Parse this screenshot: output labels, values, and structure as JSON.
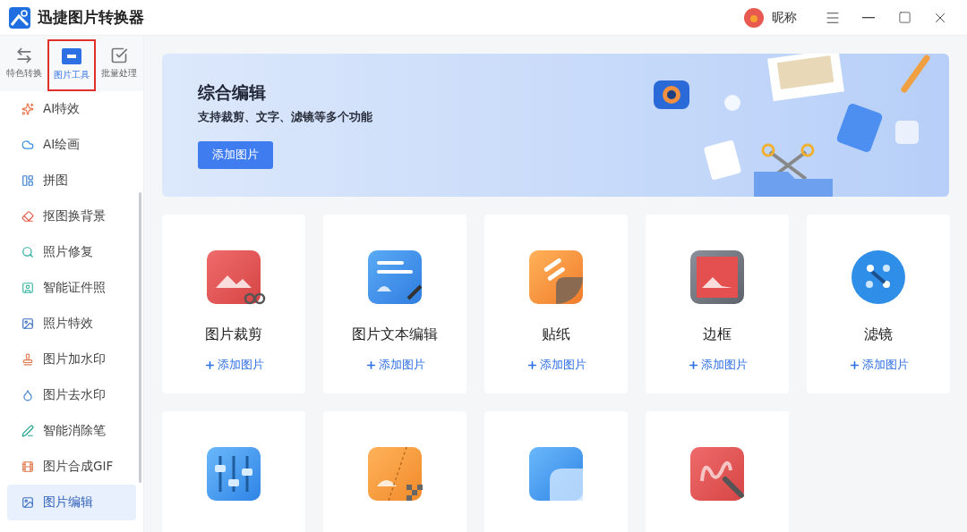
{
  "window": {
    "title": "迅捷图片转换器",
    "user": "昵称"
  },
  "mode_tabs": [
    {
      "label": "特色转换",
      "kind": "convert",
      "selected": false
    },
    {
      "label": "图片工具",
      "kind": "tools",
      "selected": true
    },
    {
      "label": "批量处理",
      "kind": "batch",
      "selected": false
    }
  ],
  "sidebar": {
    "items": [
      {
        "label": "AI特效",
        "kind": "sparkle",
        "selected": false
      },
      {
        "label": "AI绘画",
        "kind": "cloud",
        "selected": false
      },
      {
        "label": "拼图",
        "kind": "grid",
        "selected": false
      },
      {
        "label": "抠图换背景",
        "kind": "eraser",
        "selected": false
      },
      {
        "label": "照片修复",
        "kind": "search",
        "selected": false
      },
      {
        "label": "智能证件照",
        "kind": "person",
        "selected": false
      },
      {
        "label": "照片特效",
        "kind": "image",
        "selected": false
      },
      {
        "label": "图片加水印",
        "kind": "stamp",
        "selected": false
      },
      {
        "label": "图片去水印",
        "kind": "drop",
        "selected": false
      },
      {
        "label": "智能消除笔",
        "kind": "pen",
        "selected": false
      },
      {
        "label": "图片合成GIF",
        "kind": "gif",
        "selected": false
      },
      {
        "label": "图片编辑",
        "kind": "image",
        "selected": true
      }
    ]
  },
  "banner": {
    "title": "综合编辑",
    "subtitle": "支持裁剪、文字、滤镜等多个功能",
    "button": "添加图片"
  },
  "tools": [
    {
      "name": "图片裁剪",
      "kind": "crop",
      "action": "添加图片"
    },
    {
      "name": "图片文本编辑",
      "kind": "text",
      "action": "添加图片"
    },
    {
      "name": "贴纸",
      "kind": "sticker",
      "action": "添加图片"
    },
    {
      "name": "边框",
      "kind": "frame",
      "action": "添加图片"
    },
    {
      "name": "滤镜",
      "kind": "filter",
      "action": "添加图片"
    },
    {
      "kind": "adjust"
    },
    {
      "kind": "blur"
    },
    {
      "kind": "overlay"
    },
    {
      "kind": "brush"
    }
  ]
}
